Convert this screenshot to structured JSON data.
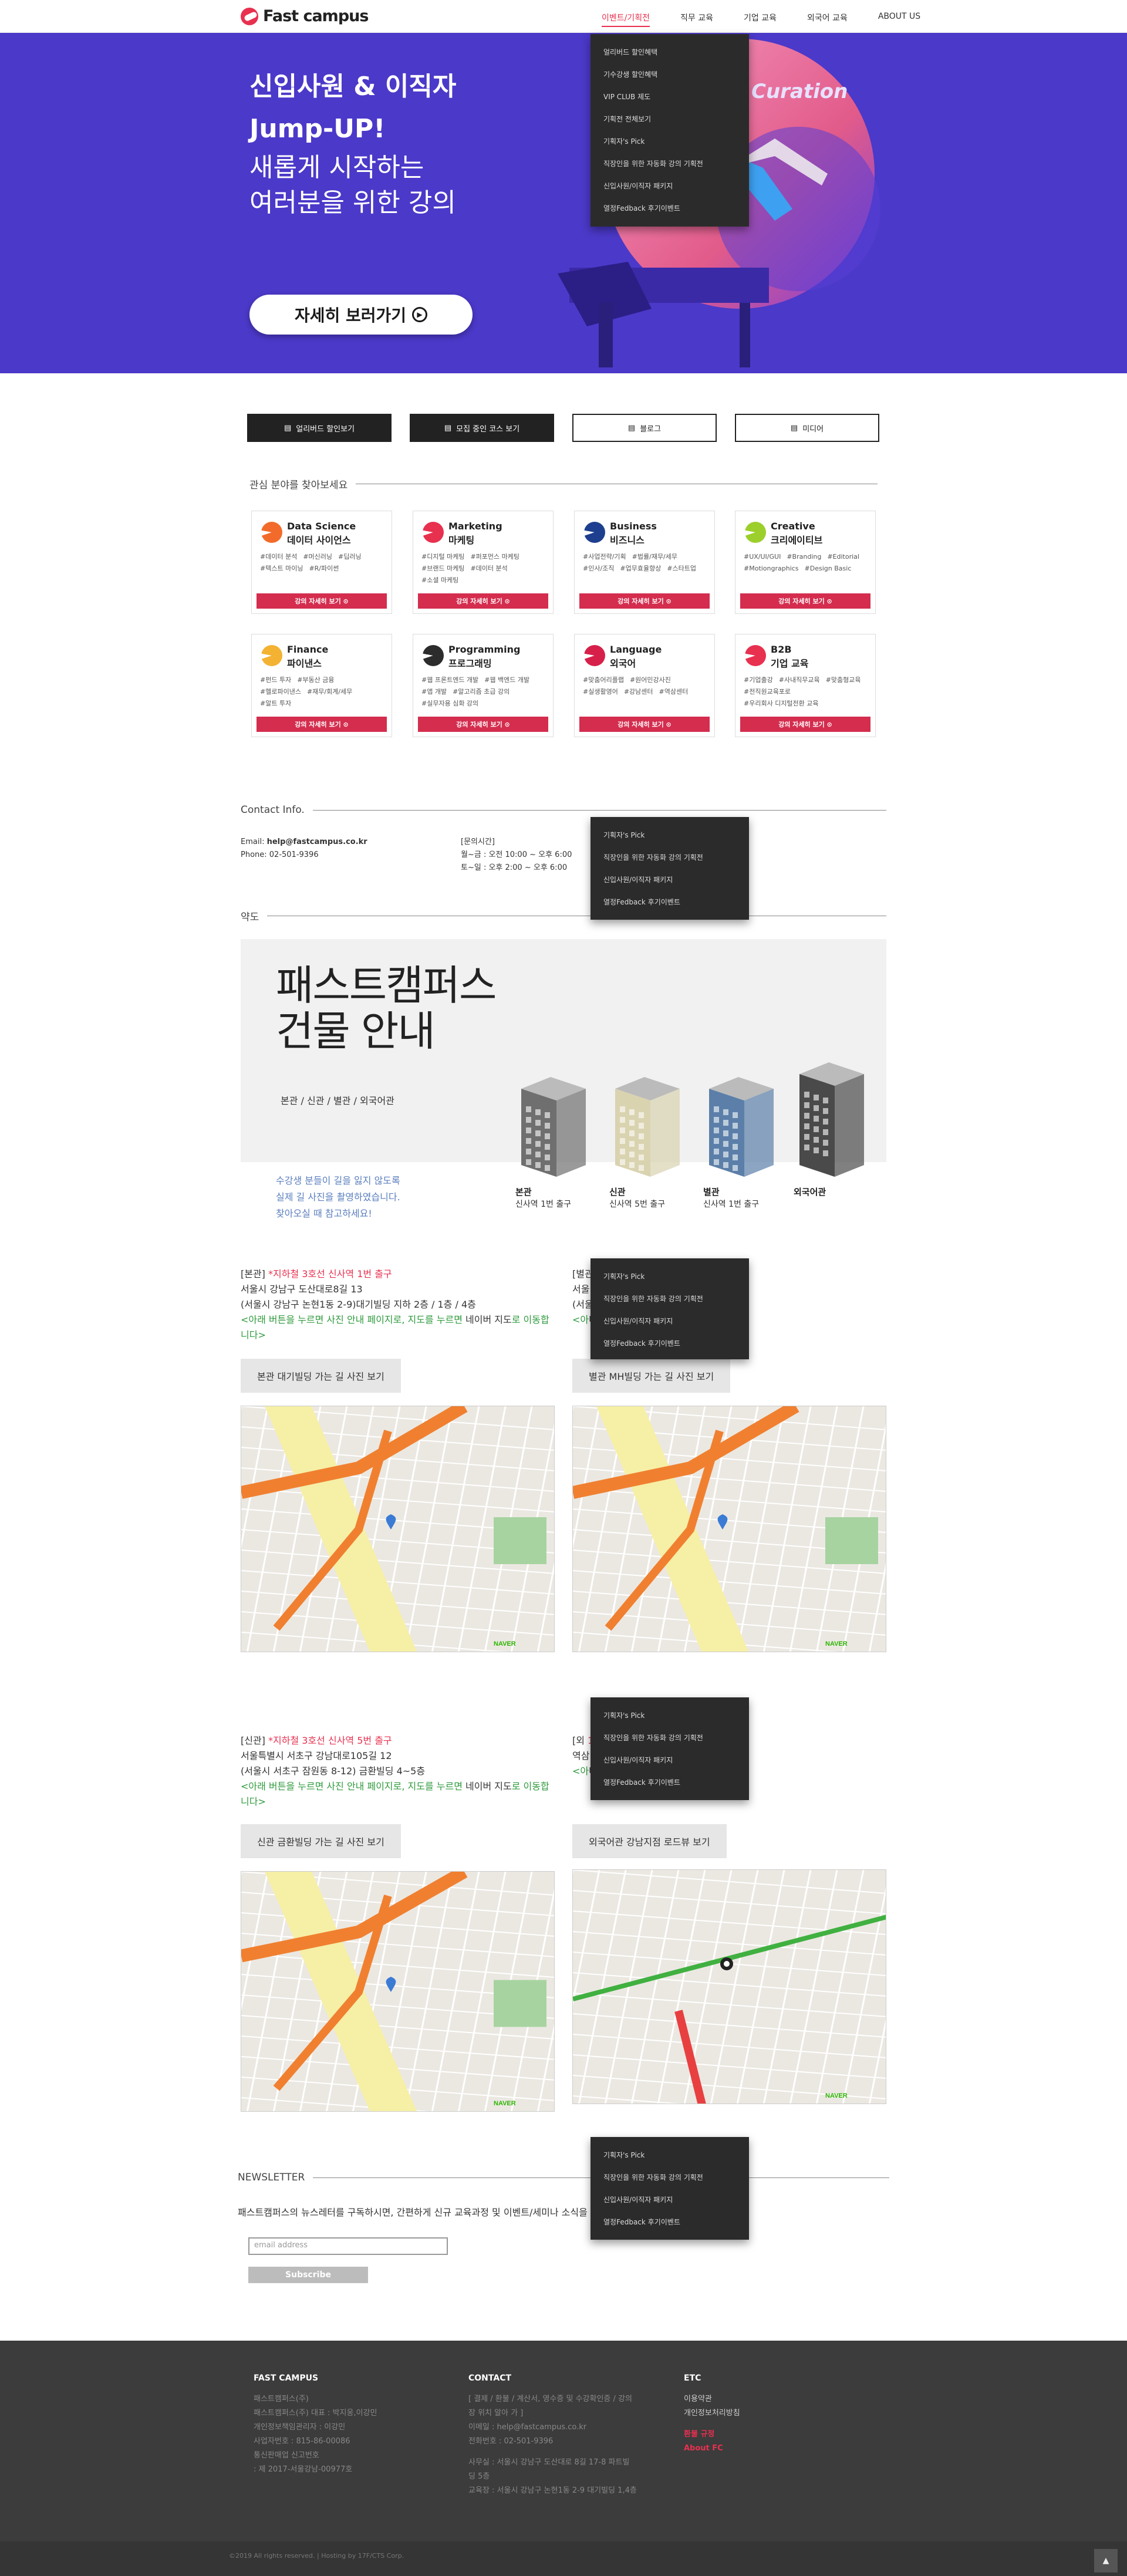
{
  "header": {
    "logo_text": "Fast campus",
    "nav": [
      "이벤트/기획전",
      "직무 교육",
      "기업 교육",
      "외국어 교육",
      "ABOUT US"
    ]
  },
  "hero": {
    "title_line1": "신입사원 & 이직자",
    "title_line2": "Jump-UP!",
    "subtitle_line1": "새롭게 시작하는",
    "subtitle_line2": "여러분을 위한 강의",
    "button_label": "자세히 보러가기",
    "deco_text": "Curation"
  },
  "dropdown": {
    "items": [
      "얼리버드 할인혜택",
      "기수강생 할인혜택",
      "VIP CLUB 제도",
      "기획전 전체보기",
      "기획자's Pick",
      "직장인을 위한 자동화 강의 기획전",
      "신입사원/이직자 패키지",
      "열정Fedback 후기이벤트"
    ]
  },
  "dropdown_short": {
    "items": [
      "기획자's Pick",
      "직장인을 위한 자동화 강의 기획전",
      "신입사원/이직자 패키지",
      "열정Fedback 후기이벤트"
    ]
  },
  "quick_buttons": [
    "얼리버드 할인보기",
    "모집 중인 코스 보기",
    "블로그",
    "미디어"
  ],
  "interests": {
    "heading": "관심 분야를 찾아보세요",
    "card_button": "강의 자세히 보기",
    "cards": [
      {
        "en": "Data Science",
        "ko": "데이터 사이언스",
        "tags": [
          "#데이터 분석",
          "#머신러닝",
          "#딥러닝",
          "#텍스트 마이닝",
          "#R/파이썬"
        ],
        "color": "#f26b2a"
      },
      {
        "en": "Marketing",
        "ko": "마케팅",
        "tags": [
          "#디지털 마케팅",
          "#퍼포먼스 마케팅",
          "#브랜드 마케팅",
          "#데이터 분석",
          "#소셜 마케팅"
        ],
        "color": "#e8304f"
      },
      {
        "en": "Business",
        "ko": "비즈니스",
        "tags": [
          "#사업전략/기획",
          "#법률/재무/세무",
          "#인사/조직",
          "#업무효율향상",
          "#스타트업"
        ],
        "color": "#1e3f8f"
      },
      {
        "en": "Creative",
        "ko": "크리에이티브",
        "tags": [
          "#UX/UI/GUI",
          "#Branding",
          "#Editorial",
          "#Motiongraphics",
          "#Design Basic"
        ],
        "color": "#9ccf2c"
      },
      {
        "en": "Finance",
        "ko": "파이낸스",
        "tags": [
          "#펀드 투자",
          "#부동산 금융",
          "#헬로파이낸스",
          "#재무/회계/세무",
          "#알트 투자"
        ],
        "color": "#f4b233"
      },
      {
        "en": "Programming",
        "ko": "프로그래밍",
        "tags": [
          "#웹 프론트엔드 개발",
          "#웹 백엔드 개발",
          "#앱 개발",
          "#알고리즘 초급 강의",
          "#실무자용 심화 강의"
        ],
        "color": "#2c2c2c"
      },
      {
        "en": "Language",
        "ko": "외국어",
        "tags": [
          "#맞춤어리플랩",
          "#원어민강사진",
          "#실생활영어",
          "#강남센터",
          "#역삼센터"
        ],
        "color": "#d6204a"
      },
      {
        "en": "B2B",
        "ko": "기업 교육",
        "tags": [
          "#기업출강",
          "#사내직무교육",
          "#맞춤형교육",
          "#전직원교육포로",
          "#우리회사 디지털전환 교육"
        ],
        "color": "#e8304f"
      }
    ]
  },
  "contact": {
    "heading": "Contact Info.",
    "email_label": "Email:",
    "email": "help@fastcampus.co.kr",
    "phone": "Phone: 02-501-9396",
    "hours_title": "[문의시간]",
    "hours1": "월~금 : 오전 10:00 ~ 오후 6:00",
    "hours2": "토~일 : 오후 2:00 ~ 오후 6:00"
  },
  "location": {
    "heading": "약도",
    "title_line1": "패스트캠퍼스",
    "title_line2": "건물 안내",
    "buildings_line": "본관 / 신관 / 별관 / 외국어관",
    "note_line1": "수강생 분들이 길을 잃지 않도록",
    "note_line2": "실제 길 사진을 촬영하였습니다.",
    "note_line3": "찾아오실 때 참고하세요!",
    "buildings": [
      {
        "name": "본관",
        "exit": "신사역 1번 출구",
        "color": "#6f6f6f"
      },
      {
        "name": "신관",
        "exit": "신사역 5번 출구",
        "color": "#d9d3b0"
      },
      {
        "name": "별관",
        "exit": "신사역 1번 출구",
        "color": "#5b7fa8"
      },
      {
        "name": "외국어관",
        "exit": "",
        "color": "#4a4a4a"
      }
    ]
  },
  "addresses": [
    {
      "tag": "[본관]",
      "highlight": "*지하철 3호선 신사역 1번 출구",
      "line1": "서울시 강남구 도산대로8길 13",
      "line2": "(서울시 강남구 논현1동 2-9)대기빌딩 지하 2층 / 1층 / 4층",
      "note_a": "<아래 버튼을 누르면 사진 안내 페이지로, 지도를 누르면 ",
      "note_b": "네이버 지도",
      "note_c": "로 이동합니다>",
      "button": "본관 대기빌딩 가는 길 사진 보기"
    },
    {
      "tag": "[별관]",
      "highlight": "",
      "line1": "서울",
      "line2": "(서울",
      "note_a": "<아",
      "note_b": "네이버 지도",
      "note_c": "로 이동합니다>",
      "button": "별관 MH빌딩 가는 길 사진 보기"
    },
    {
      "tag": "[신관]",
      "highlight": "*지하철 3호선 신사역 5번 출구",
      "line1": "서울특별시 서초구 강남대로105길 12",
      "line2": "(서울시 서초구 잠원동 8-12) 금환빌딩 4~5층",
      "note_a": "<아래 버튼을 누르면 사진 안내 페이지로, 지도를 누르면 ",
      "note_b": "네이버 지도",
      "note_c": "로 이동합니다>",
      "button": "신관 금환빌딩 가는 길 사진 보기"
    },
    {
      "tag": "[외",
      "highlight": "1번 출구",
      "line1": "역삼 114 (삼성서초역삼세무서)",
      "line2": "",
      "note_a": "<아",
      "note_b": "네이버 지도",
      "note_c": "로 이동합니다>",
      "button": "외국어관 강남지점 로드뷰 보기"
    }
  ],
  "newsletter": {
    "heading": "NEWSLETTER",
    "desc": "패스트캠퍼스의 뉴스레터를 구독하시면, 간편하게 신규 교육과정 및 이벤트/세미나 소식을",
    "placeholder": "email address",
    "button": "Subscribe"
  },
  "footer": {
    "col1_title": "FAST CAMPUS",
    "col1_lines": [
      "패스트캠퍼스(주)",
      "패스트캠퍼스(주) 대표 : 박지웅,이강민",
      "개인정보책임관리자 : 이강민",
      "사업자번호 : 815-86-00086",
      "통신판매업 신고번호",
      " : 제 2017-서울강남-00977호"
    ],
    "col2_title": "CONTACT",
    "col2_lines": [
      "[ 결제 / 환불 / 계산서, 영수증 및 수강확인증 / 강의",
      "장 위치 알아 가 ]",
      "이메일 : help@fastcampus.co.kr",
      "전화번호 : 02-501-9396",
      "",
      "사무실 : 서울시 강남구 도산대로 8길 17-8 파트빌",
      "딩 5층",
      "교육장 : 서울시 강남구 논현1동 2-9 대기빌딩 1,4층"
    ],
    "col3_title": "ETC",
    "col3_lines": [
      "이용약관",
      "개인정보처리방침"
    ],
    "col3_links": [
      "환불 규정",
      "About FC"
    ],
    "copyright": "©2019 All rights reserved. | Hosting by 17F/CTS Corp."
  }
}
